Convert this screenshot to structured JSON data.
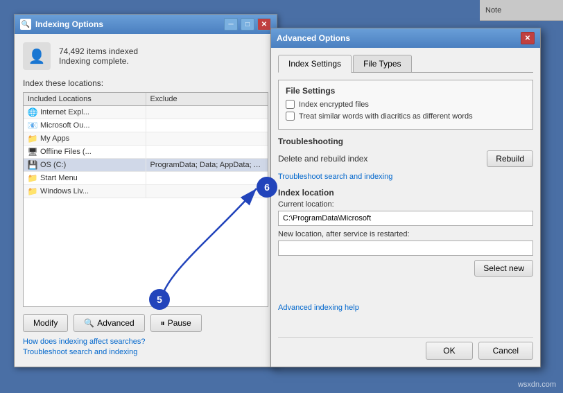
{
  "indexing_window": {
    "title": "Indexing Options",
    "items_count": "74,492 items indexed",
    "status": "Indexing complete.",
    "section_label": "Index these locations:",
    "table": {
      "headers": [
        "Included Locations",
        "Exclude"
      ],
      "rows": [
        {
          "location": "Internet Expl...",
          "exclude": "",
          "icon": "🌐"
        },
        {
          "location": "Microsoft Ou...",
          "exclude": "",
          "icon": "📧"
        },
        {
          "location": "My Apps",
          "exclude": "",
          "icon": "📁"
        },
        {
          "location": "Offline Files (...",
          "exclude": "",
          "icon": "🖥"
        },
        {
          "location": "OS (C:)",
          "exclude": "ProgramData; Data; AppData; AppData; ...",
          "icon": "💾"
        },
        {
          "location": "Start Menu",
          "exclude": "",
          "icon": "📁"
        },
        {
          "location": "Windows Liv...",
          "exclude": "",
          "icon": "📁"
        }
      ]
    },
    "buttons": {
      "modify": "Modify",
      "advanced": "Advanced",
      "pause": "Pause"
    },
    "links": {
      "how_affect": "How does indexing affect searches?",
      "troubleshoot": "Troubleshoot search and indexing"
    }
  },
  "advanced_dialog": {
    "title": "Advanced Options",
    "tabs": {
      "index_settings": "Index Settings",
      "file_types": "File Types"
    },
    "file_settings": {
      "title": "File Settings",
      "checkbox1": "Index encrypted files",
      "checkbox2": "Treat similar words with diacritics as different words"
    },
    "troubleshooting": {
      "title": "Troubleshooting",
      "rebuild_label": "Delete and rebuild index",
      "rebuild_btn": "Rebuild",
      "trouble_link": "Troubleshoot search and indexing"
    },
    "index_location": {
      "title": "Index location",
      "current_label": "Current location:",
      "current_value": "C:\\ProgramData\\Microsoft",
      "new_label": "New location, after service is restarted:",
      "new_value": "",
      "select_new_btn": "Select new"
    },
    "help_link": "Advanced indexing help",
    "footer": {
      "ok": "OK",
      "cancel": "Cancel"
    }
  },
  "annotations": {
    "five": "5",
    "six": "6"
  },
  "note": "Note",
  "watermark": "wsxdn.com"
}
